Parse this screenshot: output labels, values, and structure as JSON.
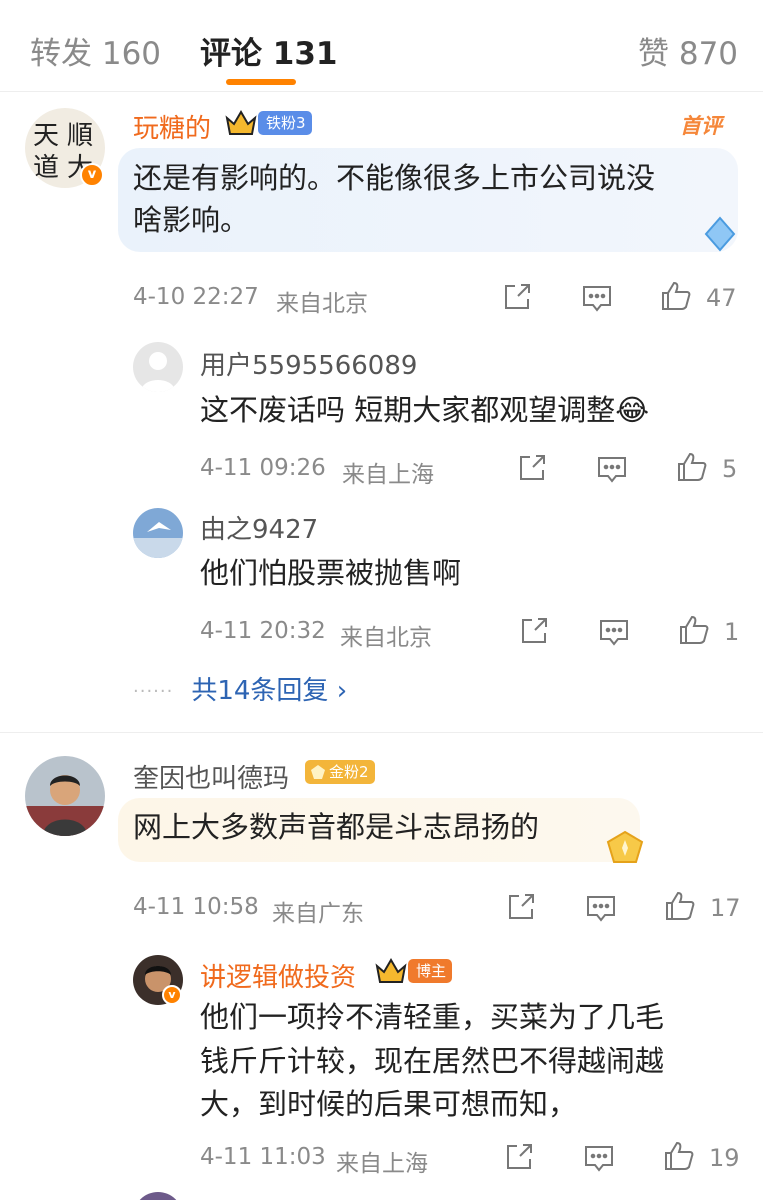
{
  "tabs": {
    "repost": "转发 160",
    "comments": "评论 131",
    "likes": "赞 870"
  },
  "comments": [
    {
      "user": "玩糖的",
      "badge": "铁粉3",
      "tag": "首评",
      "text_lines": [
        "还是有影响的。不能像很多上市公司说没",
        "啥影响。"
      ],
      "time": "4-10 22:27",
      "location": "来自北京",
      "likes": "47",
      "replies": [
        {
          "user": "用户5595566089",
          "text": "这不废话吗 短期大家都观望调整😂",
          "time": "4-11 09:26",
          "location": "来自上海",
          "likes": "5"
        },
        {
          "user": "由之9427",
          "text": "他们怕股票被抛售啊",
          "time": "4-11 20:32",
          "location": "来自北京",
          "likes": "1"
        }
      ],
      "more_replies": "共14条回复"
    },
    {
      "user": "奎因也叫德玛",
      "badge": "金粉2",
      "text_lines": [
        "网上大多数声音都是斗志昂扬的"
      ],
      "time": "4-11 10:58",
      "location": "来自广东",
      "likes": "17",
      "replies": [
        {
          "user": "讲逻辑做投资",
          "badge": "博主",
          "text_lines": [
            "他们一项拎不清轻重，买菜为了几毛",
            "钱斤斤计较，现在居然巴不得越闹越",
            "大，到时候的后果可想而知，"
          ],
          "time": "4-11 11:03",
          "location": "来自上海",
          "likes": "19"
        }
      ]
    }
  ],
  "colors": {
    "accent": "#ff8200",
    "username_orange": "#f06a1d",
    "link_blue": "#2d64b3",
    "meta_gray": "#8a8a8a"
  },
  "icons": [
    "share-icon",
    "comment-icon",
    "like-icon",
    "crown-icon",
    "gem-icon",
    "verified-icon"
  ]
}
